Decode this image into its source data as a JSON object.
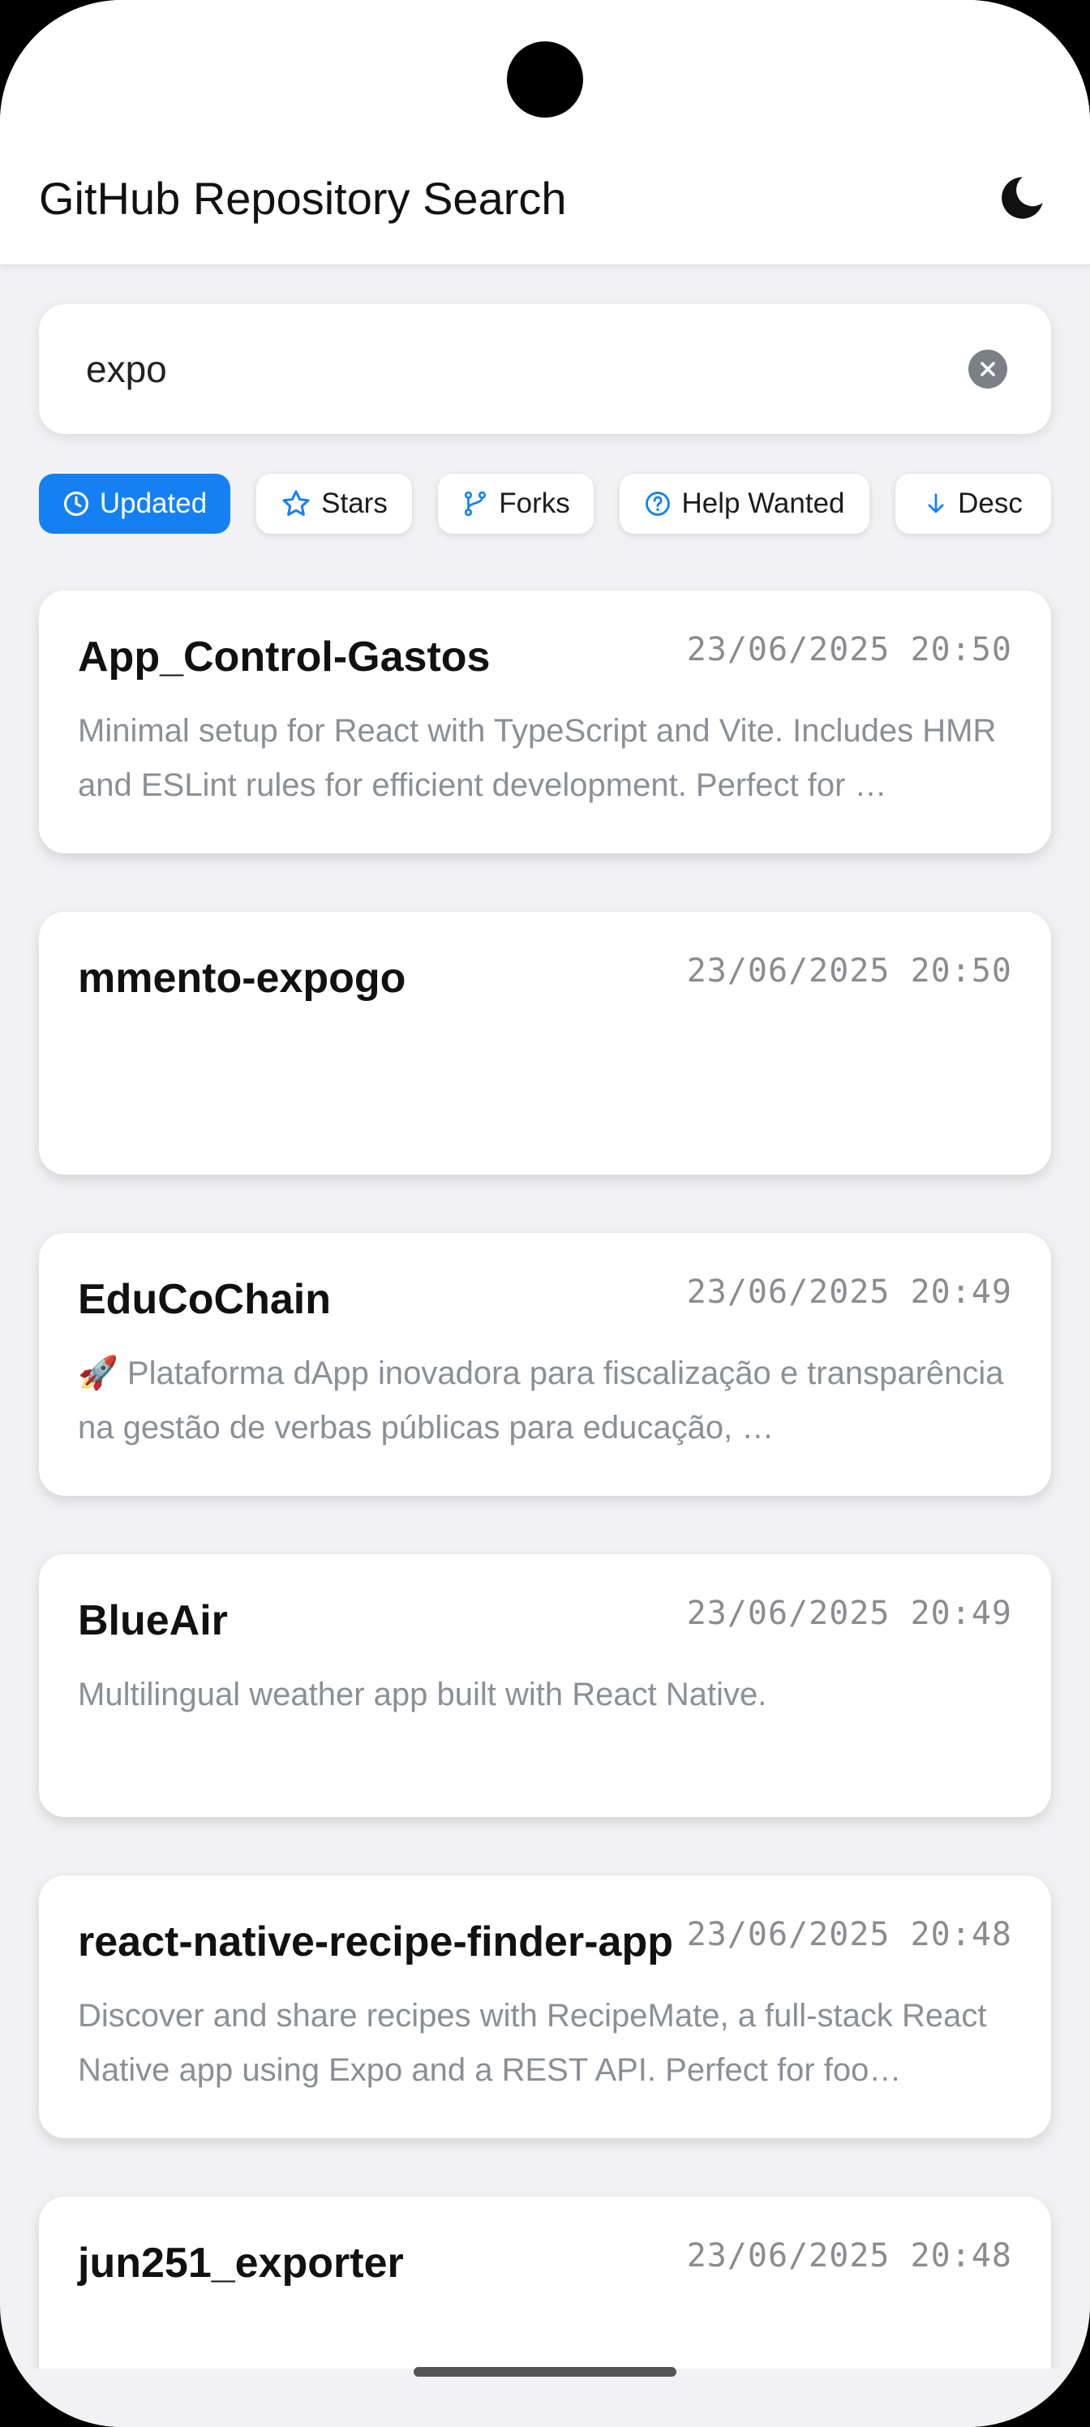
{
  "header": {
    "title": "GitHub Repository Search",
    "theme_icon": "moon-icon"
  },
  "search": {
    "value": "expo",
    "placeholder": "",
    "clear_icon": "clear-icon"
  },
  "filters": [
    {
      "label": "Updated",
      "icon": "clock-icon",
      "active": true
    },
    {
      "label": "Stars",
      "icon": "star-icon",
      "active": false
    },
    {
      "label": "Forks",
      "icon": "fork-icon",
      "active": false
    },
    {
      "label": "Help Wanted",
      "icon": "help-circle-icon",
      "active": false
    },
    {
      "label": "Desc",
      "icon": "arrow-down-icon",
      "active": false
    }
  ],
  "repos": [
    {
      "name": "App_Control-Gastos",
      "date": "23/06/2025 20:50",
      "description": "Minimal setup for React with TypeScript and Vite. Includes HMR and ESLint rules for efficient development. Perfect for …"
    },
    {
      "name": "mmento-expogo",
      "date": "23/06/2025 20:50",
      "description": ""
    },
    {
      "name": "EduCoChain",
      "date": "23/06/2025 20:49",
      "description": "🚀 Plataforma dApp inovadora para fiscalização e transparência na gestão de verbas públicas para educação, …"
    },
    {
      "name": "BlueAir",
      "date": "23/06/2025 20:49",
      "description": "Multilingual weather app built with React Native."
    },
    {
      "name": "react-native-recipe-finder-app",
      "date": "23/06/2025 20:48",
      "description": "Discover and share recipes with RecipeMate, a full-stack React Native app using Expo and a REST API. Perfect for foo…"
    },
    {
      "name": "jun251_exporter",
      "date": "23/06/2025 20:48",
      "description": ""
    }
  ],
  "colors": {
    "accent": "#1580f4",
    "background": "#f2f2f4",
    "card": "#ffffff",
    "muted_text": "#8b8f96"
  }
}
